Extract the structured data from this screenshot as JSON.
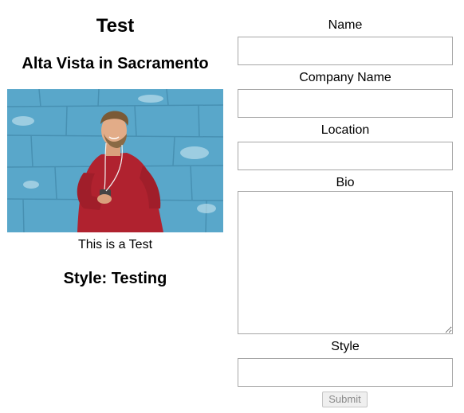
{
  "preview": {
    "name": "Test",
    "company_location": "Alta Vista in Sacramento",
    "photo_icon": "portrait-photo-icon",
    "bio": "This is a Test",
    "style": "Style: Testing"
  },
  "form": {
    "name_label": "Name",
    "name_value": "",
    "company_label": "Company Name",
    "company_value": "",
    "location_label": "Location",
    "location_value": "",
    "bio_label": "Bio",
    "bio_value": "",
    "style_label": "Style",
    "style_value": "",
    "submit_label": "Submit"
  },
  "colors": {
    "photo_wall": "#4fa3c7",
    "sweater": "#b0222f",
    "field_border": "#a6a6a6",
    "button_bg": "#efefef",
    "button_text": "#8a8a8a"
  }
}
